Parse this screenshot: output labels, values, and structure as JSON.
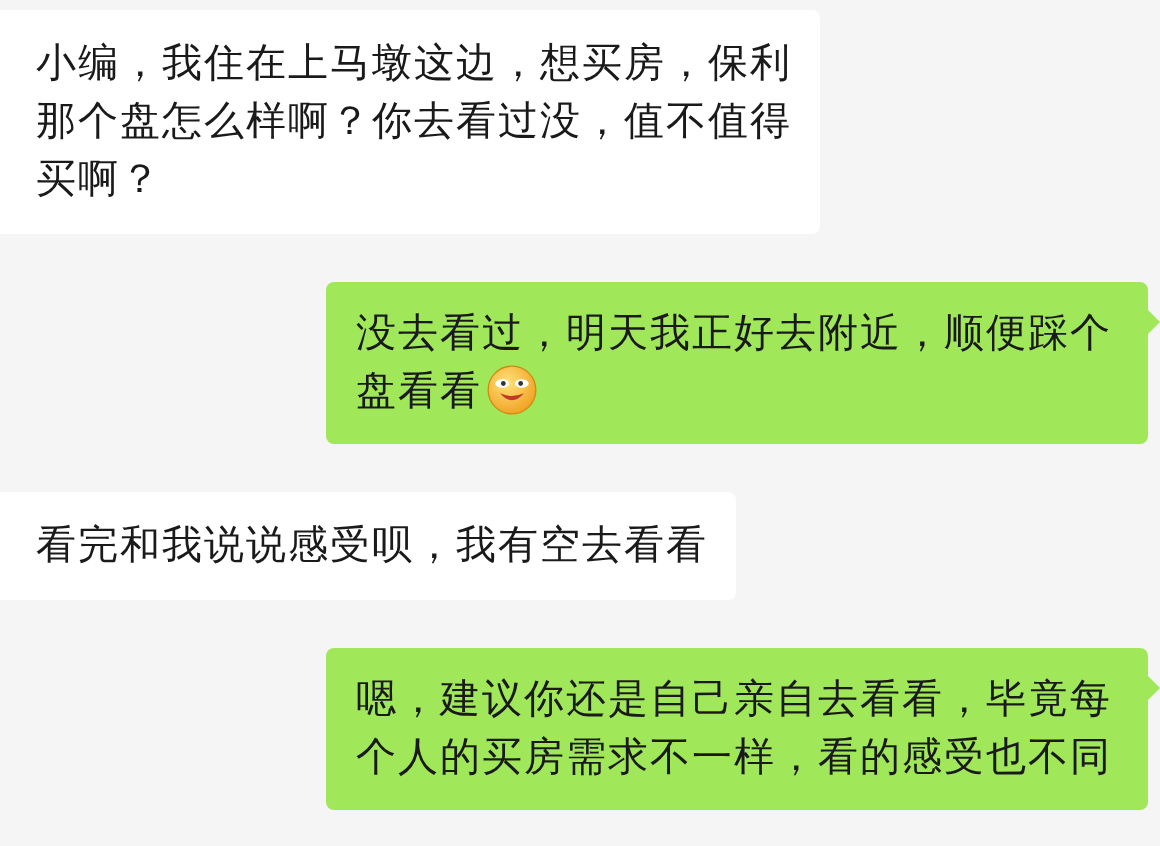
{
  "messages": [
    {
      "outgoing": false,
      "text": "小编，我住在上马墩这边，想买房，保利那个盘怎么样啊？你去看过没，值不值得买啊？",
      "emoji": false
    },
    {
      "outgoing": true,
      "text": "没去看过，明天我正好去附近，顺便踩个盘看看",
      "emoji": true
    },
    {
      "outgoing": false,
      "text": "看完和我说说感受呗，我有空去看看",
      "emoji": false
    },
    {
      "outgoing": true,
      "text": "嗯，建议你还是自己亲自去看看，毕竟每个人的买房需求不一样，看的感受也不同",
      "emoji": false
    }
  ]
}
